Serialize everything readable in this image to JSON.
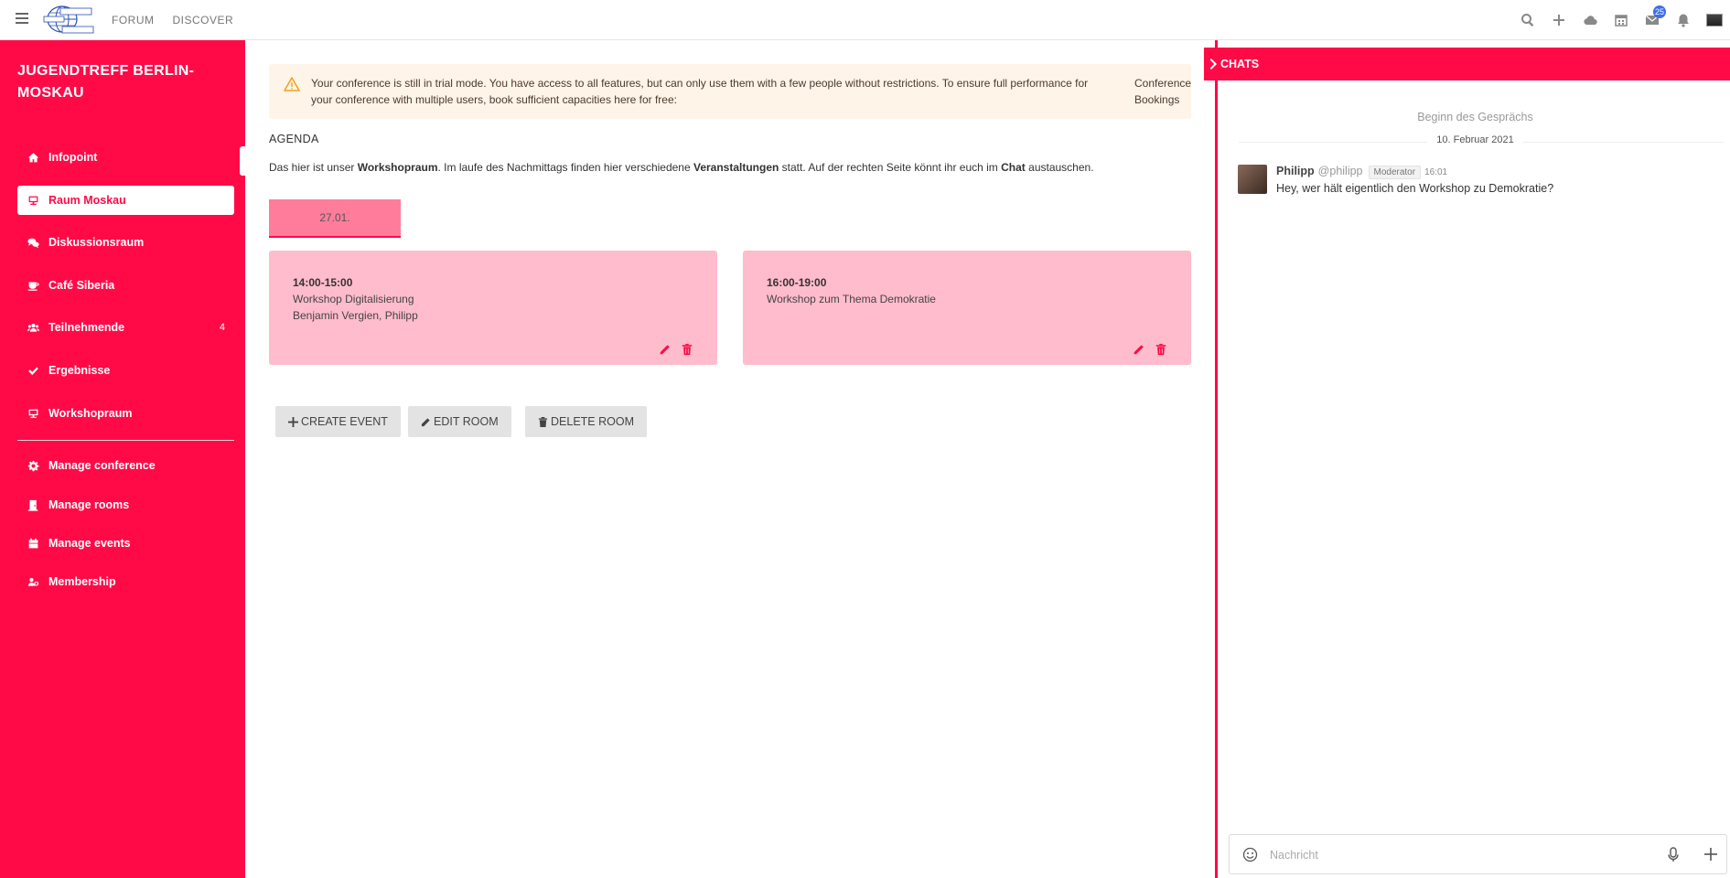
{
  "app": {
    "brand_icon": "globe-logo-icon",
    "nav": [
      {
        "label": "FORUM"
      },
      {
        "label": "DISCOVER"
      }
    ],
    "top_icons": [
      "search-icon",
      "plus-icon",
      "cloud-icon",
      "calendar-icon",
      "mail-icon",
      "bell-icon",
      "avatar"
    ],
    "mail_badge": "25",
    "accent_color": "#ff0a47"
  },
  "sidebar": {
    "title": "JUGENDTREFF BERLIN-MOSKAU",
    "items": [
      {
        "label": "Infopoint",
        "icon": "home-icon",
        "active": false
      },
      {
        "label": "Raum Moskau",
        "icon": "room-icon",
        "active": true
      },
      {
        "label": "Diskussionsraum",
        "icon": "comments-icon",
        "active": false
      },
      {
        "label": "Café Siberia",
        "icon": "coffee-icon",
        "active": false
      },
      {
        "label": "Teilnehmende",
        "icon": "users-icon",
        "active": false,
        "count": "4"
      },
      {
        "label": "Ergebnisse",
        "icon": "check-icon",
        "active": false
      },
      {
        "label": "Workshopraum",
        "icon": "room-icon",
        "active": false
      }
    ],
    "admin_items": [
      {
        "label": "Manage conference",
        "icon": "gear-icon"
      },
      {
        "label": "Manage rooms",
        "icon": "door-icon"
      },
      {
        "label": "Manage events",
        "icon": "calendar-icon"
      },
      {
        "label": "Membership",
        "icon": "membership-icon"
      }
    ]
  },
  "main": {
    "trial_notice": {
      "message": "Your conference is still in trial mode. You have access to all features, but can only use them with a few people without restrictions. To ensure full performance for your conference with multiple users, book sufficient capacities here for free:",
      "link": "Conference Bookings"
    },
    "agenda_heading": "AGENDA",
    "agenda_desc": {
      "p1": "Das hier ist unser ",
      "b1": "Workshopraum",
      "p2": ". Im laufe des Nachmittags finden hier verschiedene ",
      "b2": "Veranstaltungen",
      "p3": " statt. Auf der rechten Seite könnt ihr euch im ",
      "b3": "Chat",
      "p4": " austauschen."
    },
    "date_tab": "27.01.",
    "events": [
      {
        "time": "14:00-15:00",
        "title": "Workshop Digitalisierung",
        "people": "Benjamin Vergien, Philipp"
      },
      {
        "time": "16:00-19:00",
        "title": "Workshop zum Thema Demokratie",
        "people": ""
      }
    ],
    "buttons": {
      "create": "CREATE EVENT",
      "edit": "EDIT ROOM",
      "delete": "DELETE ROOM"
    }
  },
  "chat": {
    "header": "CHATS",
    "begin": "Beginn des Gesprächs",
    "date": "10. Februar 2021",
    "messages": [
      {
        "name": "Philipp",
        "handle": "@philipp",
        "role": "Moderator",
        "time": "16:01",
        "text": "Hey, wer hält eigentlich den Workshop zu Demokratie?"
      }
    ],
    "composer_placeholder": "Nachricht"
  }
}
